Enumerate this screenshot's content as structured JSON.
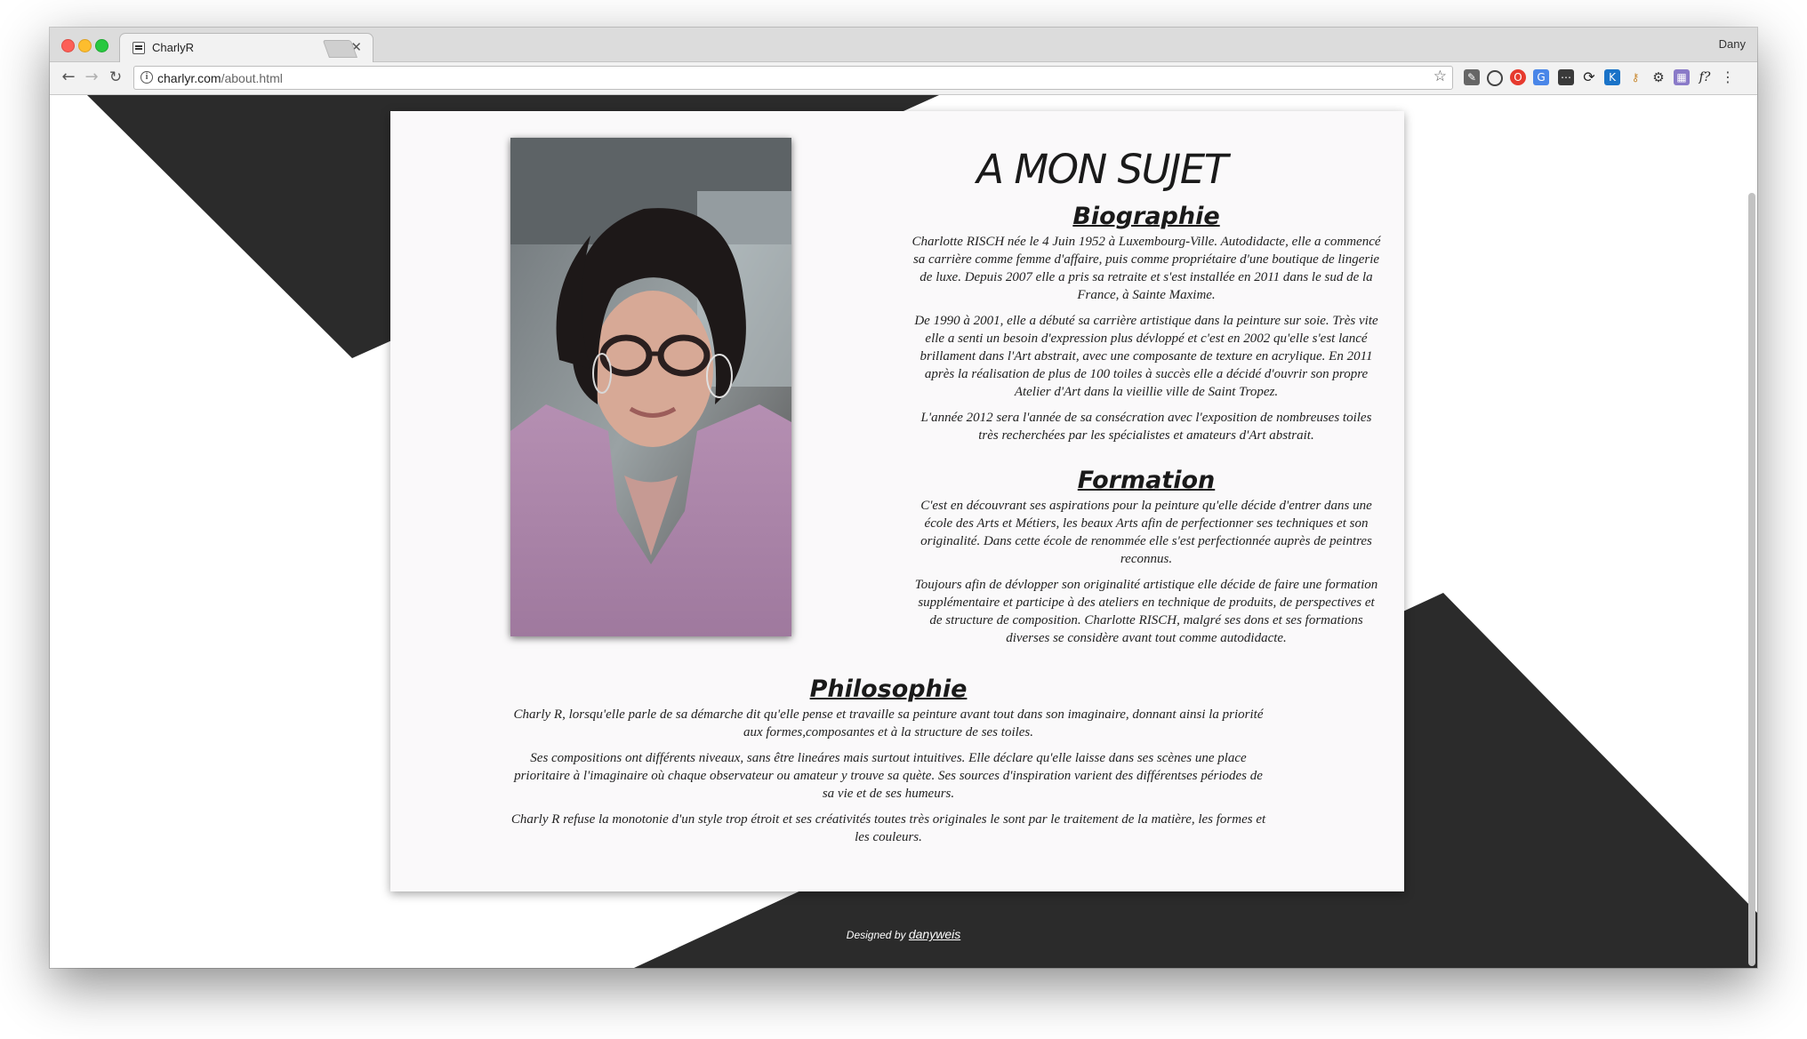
{
  "browser": {
    "tab_title": "CharlyR",
    "profile_name": "Dany",
    "url_domain": "charlyr.com",
    "url_path": "/about.html"
  },
  "page": {
    "title": "A MON SUJET",
    "biographie": {
      "heading": "Biographie",
      "paragraphs": [
        "Charlotte RISCH née le 4 Juin 1952 à Luxembourg-Ville. Autodidacte, elle a commencé sa carrière comme femme d'affaire, puis comme propriétaire d'une boutique de lingerie de luxe. Depuis 2007 elle a pris sa retraite et s'est installée en 2011 dans le sud de la France, à Sainte Maxime.",
        "De 1990 à 2001, elle a débuté sa carrière artistique dans la peinture sur soie. Très vite elle a senti un besoin d'expression plus dévloppé et c'est en 2002 qu'elle s'est lancé brillament dans l'Art abstrait, avec une composante de texture en acrylique. En 2011 après la réalisation de plus de 100 toiles à succès elle a décidé d'ouvrir son propre Atelier d'Art dans la vieillie ville de Saint Tropez.",
        "L'année 2012 sera l'année de sa consécration avec l'exposition de nombreuses toiles très recherchées par les spécialistes et amateurs d'Art abstrait."
      ]
    },
    "formation": {
      "heading": "Formation",
      "paragraphs": [
        "C'est en découvrant ses aspirations pour la peinture qu'elle décide d'entrer dans une école des Arts et Métiers, les beaux Arts afin de perfectionner ses techniques et son originalité. Dans cette école de renommée elle s'est perfectionnée auprès de peintres reconnus.",
        "Toujours afin de dévlopper son originalité artistique elle décide de faire une formation supplémentaire et participe à des ateliers en technique de produits, de perspectives et de structure de composition. Charlotte RISCH, malgré ses dons et ses formations diverses se considère avant tout comme autodidacte."
      ]
    },
    "philosophie": {
      "heading": "Philosophie",
      "paragraphs": [
        "Charly R, lorsqu'elle parle de sa démarche dit qu'elle pense et travaille sa peinture avant tout dans son imaginaire, donnant ainsi la priorité aux formes,composantes et à la structure de ses toiles.",
        "Ses compositions ont différents niveaux, sans être lineáres mais surtout intuitives. Elle déclare qu'elle laisse dans ses scènes une place prioritaire à l'imaginaire où chaque observateur ou amateur y trouve sa quète. Ses sources d'inspiration varient des différentses périodes de sa vie et de ses humeurs.",
        "Charly R refuse la monotonie d'un style trop étroit et ses créativités toutes très originales le sont par le traitement de la matière, les formes et les couleurs."
      ]
    },
    "footer": {
      "prefix": "Designed by",
      "brand": "danyweis"
    }
  },
  "colors": {
    "dark_shape": "#2b2b2b",
    "card_bg": "#faf9fa"
  },
  "icons": [
    "back-arrow-icon",
    "forward-arrow-icon",
    "reload-icon",
    "info-icon",
    "star-icon",
    "tab-close-icon"
  ]
}
